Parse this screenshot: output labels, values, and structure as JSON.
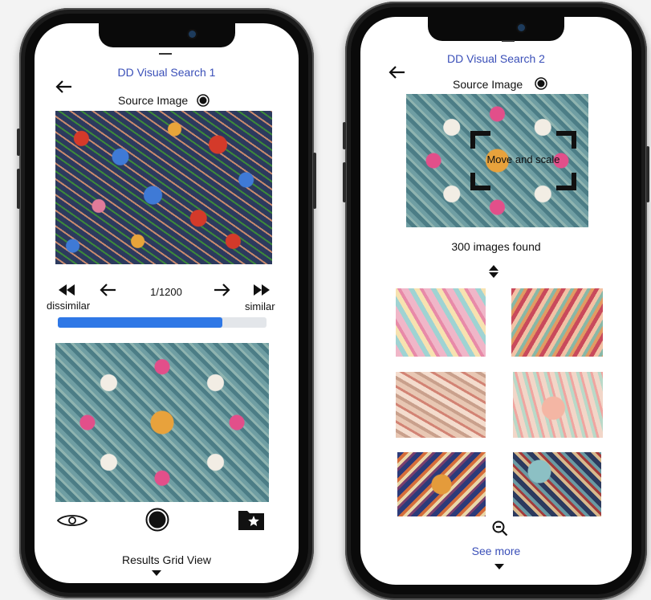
{
  "left_screen": {
    "title": "DD Visual Search 1",
    "source_image_label": "Source Image",
    "position_counter": "1/1200",
    "dissimilar_label": "dissimilar",
    "similar_label": "similar",
    "similarity_progress": 0.79,
    "results_grid_label": "Results Grid View"
  },
  "right_screen": {
    "title": "DD Visual Search 2",
    "source_image_label": "Source Image",
    "crop_overlay_label": "Move and scale",
    "images_found": "300 images found",
    "see_more_label": "See more"
  },
  "icons": {
    "back": "arrow-left-icon",
    "radio": "radio-button-icon",
    "fast_rewind": "fast-rewind-icon",
    "prev": "arrow-left-icon",
    "next": "arrow-right-icon",
    "fast_forward": "fast-forward-icon",
    "eye": "eye-icon",
    "record": "record-icon",
    "folder_star": "folder-star-icon",
    "sort": "sort-icon",
    "zoom_out": "zoom-out-icon",
    "caret_down": "caret-down-icon"
  },
  "colors": {
    "title_blue": "#3a4fb8",
    "progress_fill": "#2f78e6",
    "progress_track": "#e3e6ea"
  }
}
